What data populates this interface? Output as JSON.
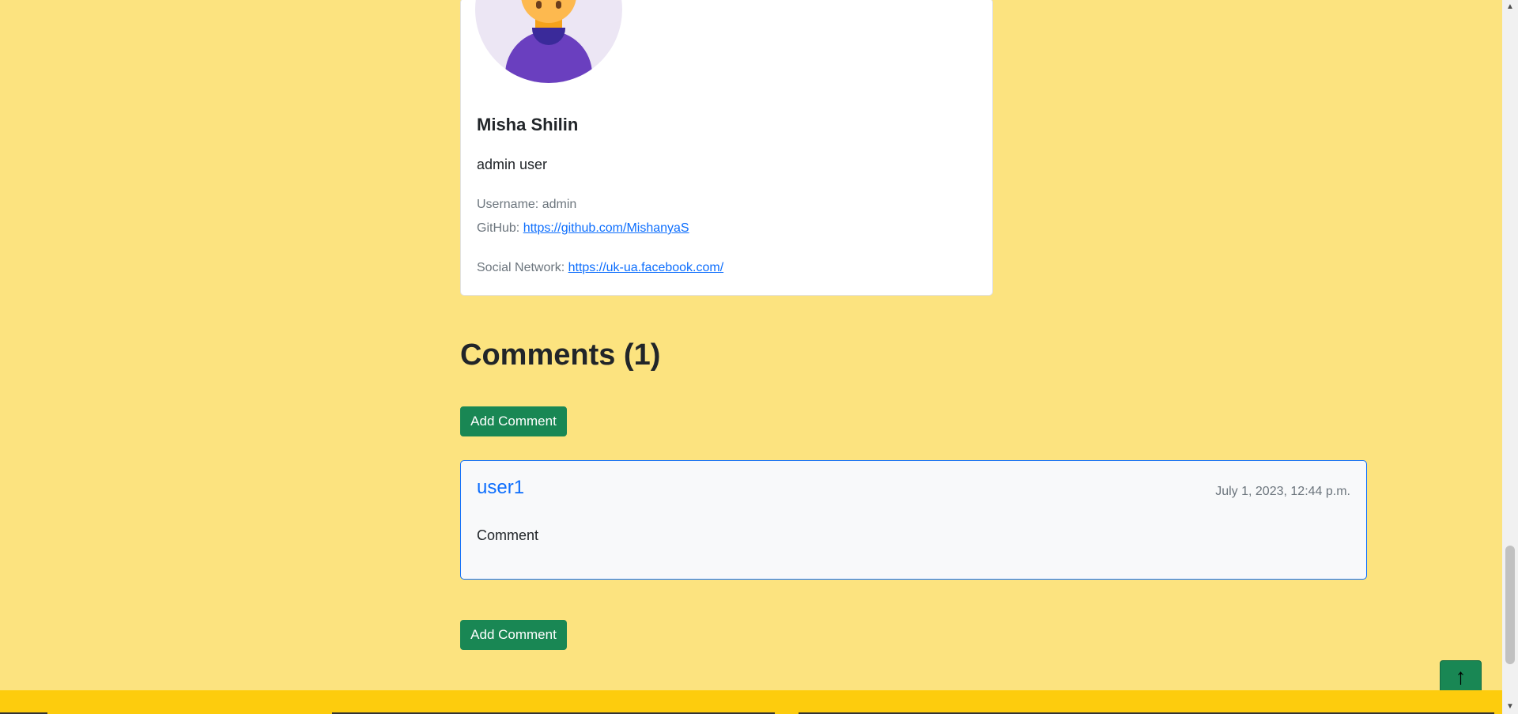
{
  "profile": {
    "name": "Misha Shilin",
    "bio": "admin user",
    "username_label": "Username: admin",
    "github_label": "GitHub:",
    "github_url": "https://github.com/MishanyaS",
    "social_label": "Social Network:",
    "social_url": "https://uk-ua.facebook.com/"
  },
  "comments": {
    "title": "Comments (1)",
    "add_button_label": "Add Comment",
    "items": [
      {
        "author": "user1",
        "date": "July 1, 2023, 12:44 p.m.",
        "text": "Comment"
      }
    ]
  },
  "scroll_top": {
    "icon": "arrow-up-icon",
    "glyph": "↑"
  },
  "colors": {
    "page_background": "#fce37f",
    "footer": "#fdcc0d",
    "success_button": "#198754",
    "link": "#0d6efd"
  }
}
